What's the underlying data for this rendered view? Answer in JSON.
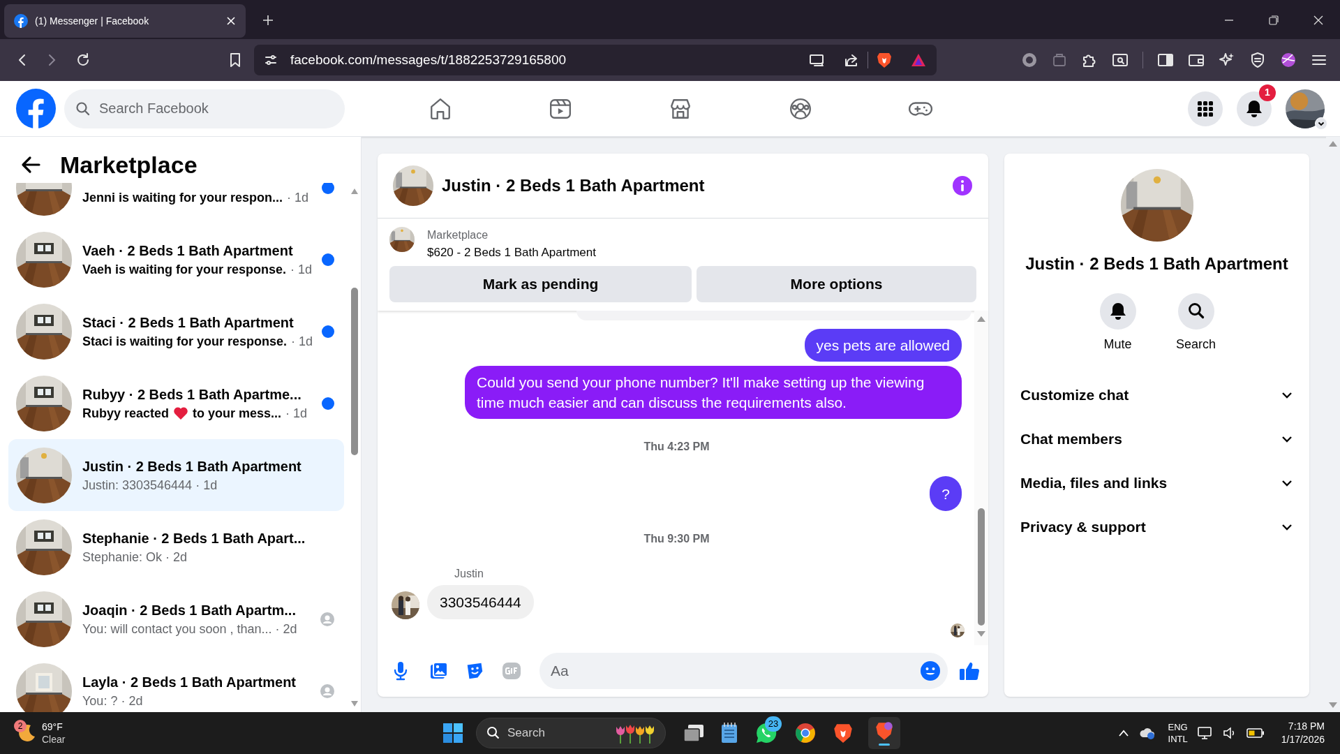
{
  "browser": {
    "tab_title": "(1) Messenger | Facebook",
    "url": "facebook.com/messages/t/1882253729165800"
  },
  "header": {
    "search_placeholder": "Search Facebook",
    "notification_count": "1"
  },
  "sidebar": {
    "title": "Marketplace",
    "conversations": [
      {
        "preview": "Jenni is waiting for your respon...",
        "time": "· 1d",
        "unread": true,
        "seen": false,
        "selected": false
      },
      {
        "title": "Vaeh · 2 Beds 1 Bath Apartment",
        "preview": "Vaeh is waiting for your response.",
        "time": "· 1d",
        "unread": true,
        "seen": false,
        "selected": false
      },
      {
        "title": "Staci · 2 Beds 1 Bath Apartment",
        "preview": "Staci is waiting for your response.",
        "time": "· 1d",
        "unread": true,
        "seen": false,
        "selected": false
      },
      {
        "title": "Rubyy · 2 Beds 1 Bath Apartme...",
        "preview": "Rubyy reacted",
        "reaction": true,
        "preview_after": "to your mess...",
        "time": "· 1d",
        "unread": true,
        "seen": false,
        "selected": false
      },
      {
        "title": "Justin · 2 Beds 1 Bath Apartment",
        "preview": "Justin: 3303546444 · 1d",
        "unread": false,
        "seen": false,
        "selected": true
      },
      {
        "title": "Stephanie · 2 Beds 1 Bath Apart...",
        "preview": "Stephanie: Ok · 2d",
        "unread": false,
        "seen": false,
        "selected": false
      },
      {
        "title": "Joaqin · 2 Beds 1 Bath Apartm...",
        "preview": "You: will contact you soon , than... · 2d",
        "unread": false,
        "seen": true,
        "selected": false
      },
      {
        "title": "Layla · 2 Beds 1 Bath Apartment",
        "preview": "You: ? · 2d",
        "unread": false,
        "seen": true,
        "selected": false
      }
    ]
  },
  "chat": {
    "title": "Justin · 2 Beds 1 Bath Apartment",
    "listing": {
      "label": "Marketplace",
      "text": "$620 - 2 Beds 1 Bath Apartment"
    },
    "actions": [
      "Mark as pending",
      "More options"
    ],
    "messages": [
      {
        "kind": "outgoing",
        "text": "yes pets are allowed",
        "color": "#5b3cf6"
      },
      {
        "kind": "outgoing",
        "text": "Could you send your phone number? It'll make setting up the viewing time much easier and can discuss the requirements also.",
        "color": "#8a1cf7"
      },
      {
        "kind": "timestamp",
        "text": "Thu 4:23 PM"
      },
      {
        "kind": "outgoing",
        "text": "?",
        "color": "#5b3cf6"
      },
      {
        "kind": "timestamp",
        "text": "Thu 9:30 PM"
      },
      {
        "kind": "incoming",
        "sender": "Justin",
        "text": "3303546444"
      }
    ],
    "composer_placeholder": "Aa"
  },
  "details": {
    "title": "Justin · 2 Beds 1 Bath Apartment",
    "actions": [
      "Mute",
      "Search"
    ],
    "sections": [
      {
        "label": "Customize chat",
        "expanded": false
      },
      {
        "label": "Chat members",
        "expanded": false
      },
      {
        "label": "Media, files and links",
        "expanded": false
      },
      {
        "label": "Privacy & support",
        "expanded": false
      }
    ]
  },
  "taskbar": {
    "weather": {
      "badge": "2",
      "temp": "69°F",
      "condition": "Clear"
    },
    "search": "Search",
    "whatsapp_badge": "23",
    "language": [
      "ENG",
      "INTL"
    ],
    "time": "7:18 PM",
    "date": "1/17/2026"
  }
}
